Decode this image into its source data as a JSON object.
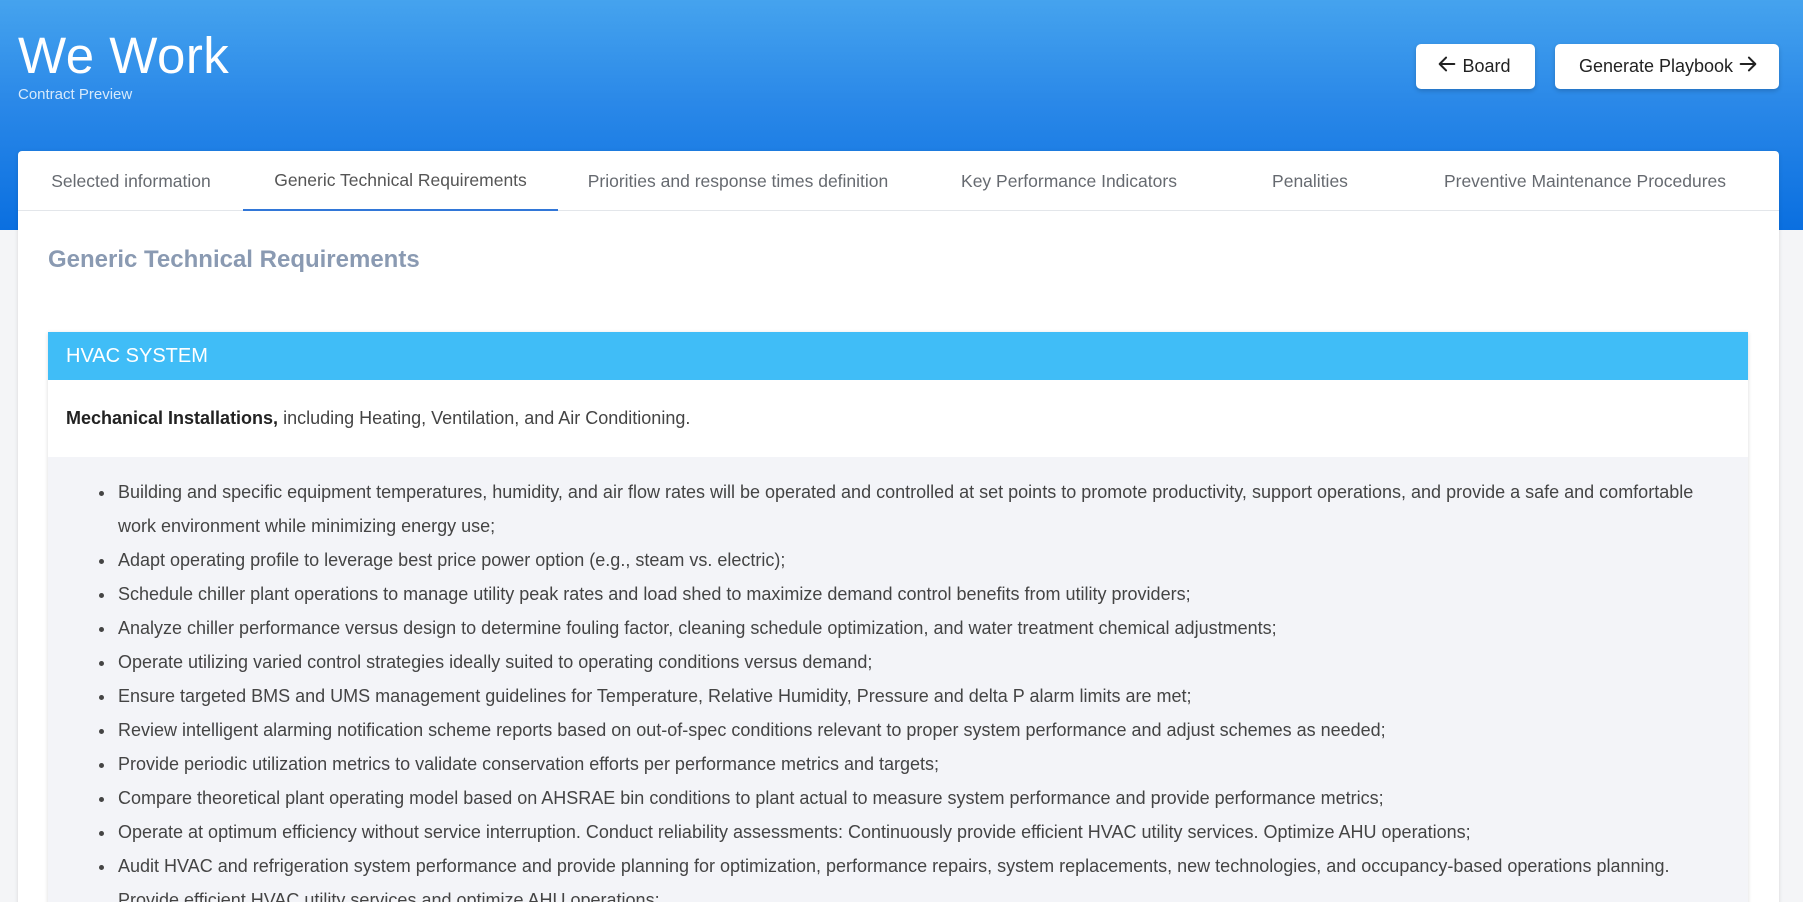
{
  "header": {
    "title": "We Work",
    "subtitle": "Contract Preview",
    "board_button": "Board",
    "playbook_button": "Generate Playbook"
  },
  "tabs": [
    {
      "label": "Selected information",
      "active": false
    },
    {
      "label": "Generic Technical Requirements",
      "active": true
    },
    {
      "label": "Priorities and response times definition",
      "active": false
    },
    {
      "label": "Key Performance Indicators",
      "active": false
    },
    {
      "label": "Penalities",
      "active": false
    },
    {
      "label": "Preventive Maintenance Procedures",
      "active": false
    }
  ],
  "content": {
    "section_title": "Generic Technical Requirements",
    "panel": {
      "header": "HVAC SYSTEM",
      "intro_bold": "Mechanical Installations,",
      "intro_rest": " including Heating, Ventilation, and Air Conditioning.",
      "items": [
        "Building and specific equipment temperatures, humidity, and air flow rates will be operated and controlled at set points to promote productivity, support operations, and provide a safe and comfortable work environment while minimizing energy use;",
        "Adapt operating profile to leverage best price power option (e.g., steam vs. electric);",
        "Schedule chiller plant operations to manage utility peak rates and load shed to maximize demand control benefits from utility providers;",
        "Analyze chiller performance versus design to determine fouling factor, cleaning schedule optimization, and water treatment chemical adjustments;",
        "Operate utilizing varied control strategies ideally suited to operating conditions versus demand;",
        "Ensure targeted BMS and UMS management guidelines for Temperature, Relative Humidity, Pressure and delta P alarm limits are met;",
        "Review intelligent alarming notification scheme reports based on out-of-spec conditions relevant to proper system performance and adjust schemes as needed;",
        "Provide periodic utilization metrics to validate conservation efforts per performance metrics and targets;",
        "Compare theoretical plant operating model based on AHSRAE bin conditions to plant actual to measure system performance and provide performance metrics;",
        "Operate at optimum efficiency without service interruption.  Conduct reliability assessments: Continuously provide efficient HVAC utility services.  Optimize AHU operations;",
        "Audit HVAC and refrigeration system performance and provide planning for optimization, performance repairs, system replacements, new technologies, and occupancy-based operations planning.  Provide efficient HVAC utility services and optimize AHU operations;"
      ]
    }
  },
  "icons": {
    "board": "arrow-left-icon",
    "playbook": "arrow-right-icon"
  },
  "colors": {
    "header_gradient_top": "#45a3ee",
    "header_gradient_bottom": "#0a6fe0",
    "panel_header": "#40bdf7",
    "active_tab_underline": "#3277d8",
    "section_title": "#8a9ab2"
  }
}
